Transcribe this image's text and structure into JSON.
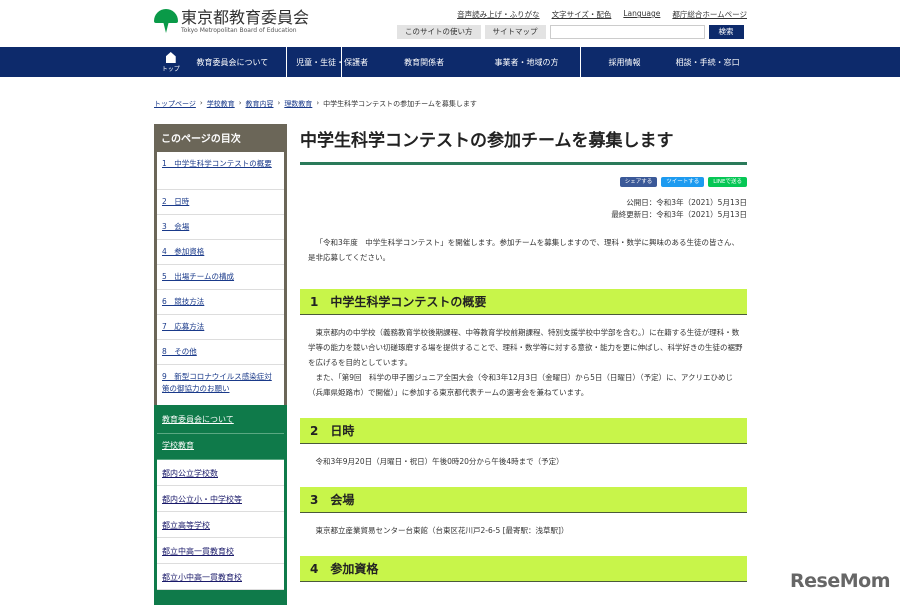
{
  "header": {
    "logo_jp": "東京都教育委員会",
    "logo_en": "Tokyo Metropolitan Board of Education",
    "top_links": [
      "音声読み上げ・ふりがな",
      "文字サイズ・配色",
      "Language",
      "都庁総合ホームページ"
    ],
    "usage_button": "このサイトの使い方",
    "sitemap_button": "サイトマップ",
    "search_placeholder": "",
    "search_button": "検索"
  },
  "nav": {
    "home": "トップ",
    "items": [
      "教育委員会について",
      "児童・生徒・保護者",
      "教育関係者",
      "事業者・地域の方",
      "採用情報",
      "相談・手続・窓口"
    ]
  },
  "breadcrumb": [
    "トップページ",
    "学校教育",
    "教育内容",
    "理数教育",
    "中学生科学コンテストの参加チームを募集します"
  ],
  "toc": {
    "title": "このページの目次",
    "items": [
      "1　中学生科学コンテストの概要",
      "2　日時",
      "3　会場",
      "4　参加資格",
      "5　出場チームの構成",
      "6　競技方法",
      "7　応募方法",
      "8　その他",
      "9　新型コロナウイルス感染症対策の御協力のお願い"
    ]
  },
  "side_nav": {
    "sections": [
      "教育委員会について",
      "学校教育"
    ],
    "items": [
      "都内公立学校数",
      "都内公立小・中学校等",
      "都立高等学校",
      "都立中高一貫教育校",
      "都立小中高一貫教育校"
    ]
  },
  "main": {
    "title": "中学生科学コンテストの参加チームを募集します",
    "share": {
      "facebook": "シェアする",
      "twitter": "ツイートする",
      "line": "LINEで送る"
    },
    "published": "公開日：令和3年（2021）5月13日",
    "updated": "最終更新日：令和3年（2021）5月13日",
    "intro": "「令和3年度　中学生科学コンテスト」を開催します。参加チームを募集しますので、理科・数学に興味のある生徒の皆さん、是非応募してください。",
    "sections": [
      {
        "heading": "1　中学生科学コンテストの概要",
        "paragraphs": [
          "東京都内の中学校（義務教育学校後期課程、中等教育学校前期課程、特別支援学校中学部を含む。）に在籍する生徒が理科・数学等の能力を競い合い切磋琢磨する場を提供することで、理科・数学等に対する意欲・能力を更に伸ばし、科学好きの生徒の裾野を広げるを目的としています。",
          "また、「第9回　科学の甲子園ジュニア全国大会（令和3年12月3日（金曜日）から5日（日曜日）（予定）に、アクリエひめじ（兵庫県姫路市）で開催）」に参加する東京都代表チームの選考会を兼ねています。"
        ]
      },
      {
        "heading": "2　日時",
        "paragraphs": [
          "令和3年9月20日（月曜日・祝日）午後0時20分から午後4時まで（予定）"
        ]
      },
      {
        "heading": "3　会場",
        "paragraphs": [
          "東京都立産業貿易センター台東館（台東区花川戸2-6-5 [最寄駅：浅草駅]）"
        ]
      },
      {
        "heading": "4　参加資格",
        "paragraphs": []
      }
    ]
  },
  "watermark": "ReseMom"
}
